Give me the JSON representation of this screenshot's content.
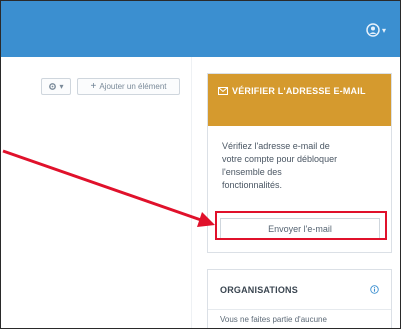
{
  "toolbar": {
    "settings_icon": "gear-icon",
    "add_label": "Ajouter un élément"
  },
  "verify": {
    "title": "VÉRIFIER L'ADRESSE E-MAIL",
    "title_icon": "envelope-icon",
    "message": "Vérifiez l'adresse e-mail de votre compte pour débloquer l'ensemble des fonctionnalités.",
    "button_label": "Envoyer l'e-mail"
  },
  "organisations": {
    "title": "ORGANISATIONS",
    "body": "Vous ne faites partie d'aucune"
  },
  "colors": {
    "topbar": "#3b8fd0",
    "warning": "#d59a2e",
    "highlight": "#e0112b"
  }
}
